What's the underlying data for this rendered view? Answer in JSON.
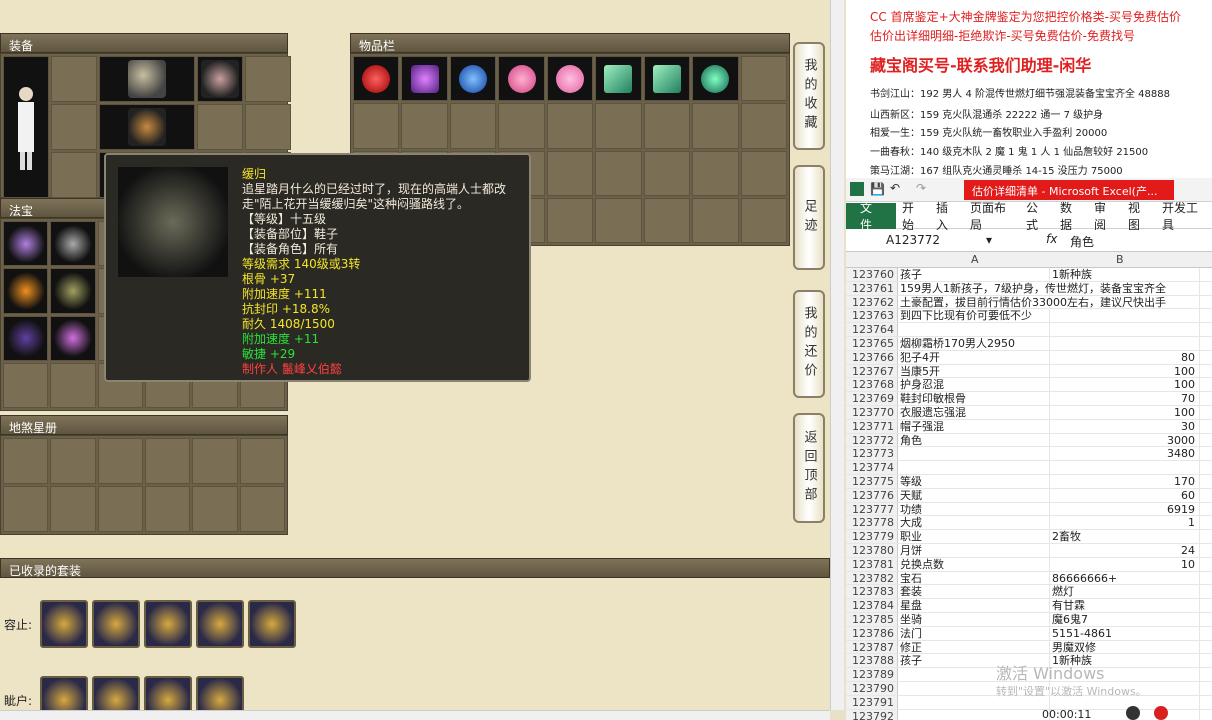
{
  "left_panel": {
    "equip_title": "装备",
    "treasure_title": "法宝",
    "star_title": "地煞星册",
    "inventory_title": "物品栏",
    "sets_title": "已收录的套装",
    "set_rows": [
      {
        "label": "容止:"
      },
      {
        "label": "眦户:"
      }
    ]
  },
  "side_buttons": [
    {
      "label": "我的收藏"
    },
    {
      "label": "足迹"
    },
    {
      "label": "我的还价"
    },
    {
      "label": "返回顶部"
    }
  ],
  "tooltip": {
    "name": "缓归",
    "desc1": "追星踏月什么的已经过时了，现在的高端人士都改",
    "desc2": "走\"陌上花开当缓缓归矣\"这种闷骚路线了。",
    "level": "【等级】十五级",
    "part": "【装备部位】鞋子",
    "role": "【装备角色】所有",
    "req": "等级需求 140级或3转",
    "bone": "根骨 +37",
    "speed": "附加速度 +111",
    "seal": "抗封印 +18.8%",
    "durability": "耐久 1408/1500",
    "speed2": "附加速度 +11",
    "agility": "敏捷 +29",
    "maker": "制作人 鬣峰乂伯懿"
  },
  "ad": {
    "top_line": "CC 首席鉴定+大神金牌鉴定为您把控价格类-买号免费估价",
    "line2": "估价出详细明细-拒绝欺诈-买号免费估价-免费找号",
    "headline": "藏宝阁买号-联系我们助理-闲华",
    "listings": [
      "书剑江山：192 男人 4 阶混传世燃灯细节强混装备宝宝齐全 48888",
      "山西新区：159 克火队混通杀 22222 通一 7 级护身",
      "相爱一生：159 克火队统一畜牧职业入手盈利 20000",
      "一曲春秋：140 级克木队 2 魔 1 鬼 1 人 1 仙品詹较好 21500",
      "策马江湖：167 组队克火通灵睡杀 14-15 没压力 75000"
    ]
  },
  "excel": {
    "title": "估价详细清单 - Microsoft Excel(产...",
    "tabs": [
      "文件",
      "开始",
      "插入",
      "页面布局",
      "公式",
      "数据",
      "审阅",
      "视图",
      "开发工具"
    ],
    "name_box": "A123772",
    "fx": "fx",
    "formula": "角色",
    "col_a": "A",
    "col_b": "B",
    "rows": [
      {
        "n": "123760",
        "a": "孩子",
        "b": "1新种族",
        "num": false
      },
      {
        "n": "123761",
        "a": "159男人1新孩子，7级护身，传世燃灯，装备宝宝齐全",
        "b": "",
        "num": false
      },
      {
        "n": "123762",
        "a": "土豪配置，拔目前行情估价33000左右，建议尺快出手",
        "b": "",
        "num": false
      },
      {
        "n": "123763",
        "a": "到四下比现有价可要低不少",
        "b": "",
        "num": false
      },
      {
        "n": "123764",
        "a": "",
        "b": "",
        "num": false
      },
      {
        "n": "123765",
        "a": "烟柳霜桥170男人2950",
        "b": "",
        "num": false
      },
      {
        "n": "123766",
        "a": "犯子4开",
        "b": "80",
        "num": true
      },
      {
        "n": "123767",
        "a": "当康5开",
        "b": "100",
        "num": true
      },
      {
        "n": "123768",
        "a": "护身忍混",
        "b": "100",
        "num": true
      },
      {
        "n": "123769",
        "a": "鞋封印敏根骨",
        "b": "70",
        "num": true
      },
      {
        "n": "123770",
        "a": "衣服遗忘强混",
        "b": "100",
        "num": true
      },
      {
        "n": "123771",
        "a": "帽子强混",
        "b": "30",
        "num": true
      },
      {
        "n": "123772",
        "a": "角色",
        "b": "3000",
        "num": true
      },
      {
        "n": "123773",
        "a": "",
        "b": "3480",
        "num": true
      },
      {
        "n": "123774",
        "a": "",
        "b": "",
        "num": false
      },
      {
        "n": "123775",
        "a": "等级",
        "b": "170",
        "num": true
      },
      {
        "n": "123776",
        "a": "天赋",
        "b": "60",
        "num": true
      },
      {
        "n": "123777",
        "a": "功绩",
        "b": "6919",
        "num": true
      },
      {
        "n": "123778",
        "a": "大成",
        "b": "1",
        "num": true
      },
      {
        "n": "123779",
        "a": "职业",
        "b": "2畜牧",
        "num": false
      },
      {
        "n": "123780",
        "a": "月饼",
        "b": "24",
        "num": true
      },
      {
        "n": "123781",
        "a": "兑换点数",
        "b": "10",
        "num": true
      },
      {
        "n": "123782",
        "a": "宝石",
        "b": "86666666+",
        "num": false
      },
      {
        "n": "123783",
        "a": "套装",
        "b": "燃灯",
        "num": false
      },
      {
        "n": "123784",
        "a": "星盘",
        "b": "有甘霖",
        "num": false
      },
      {
        "n": "123785",
        "a": "坐骑",
        "b": "魔6鬼7",
        "num": false
      },
      {
        "n": "123786",
        "a": "法门",
        "b": "5151-4861",
        "num": false
      },
      {
        "n": "123787",
        "a": "修正",
        "b": "男魔双修",
        "num": false
      },
      {
        "n": "123788",
        "a": "孩子",
        "b": "1新种族",
        "num": false
      },
      {
        "n": "123789",
        "a": "",
        "b": "",
        "num": false
      },
      {
        "n": "123790",
        "a": "",
        "b": "",
        "num": false
      },
      {
        "n": "123791",
        "a": "",
        "b": "",
        "num": false
      },
      {
        "n": "123792",
        "a": "",
        "b": "",
        "num": false
      }
    ]
  },
  "watermark": {
    "line1": "激活 Windows",
    "line2": "转到\"设置\"以激活 Windows。"
  },
  "timer": "00:00:11"
}
